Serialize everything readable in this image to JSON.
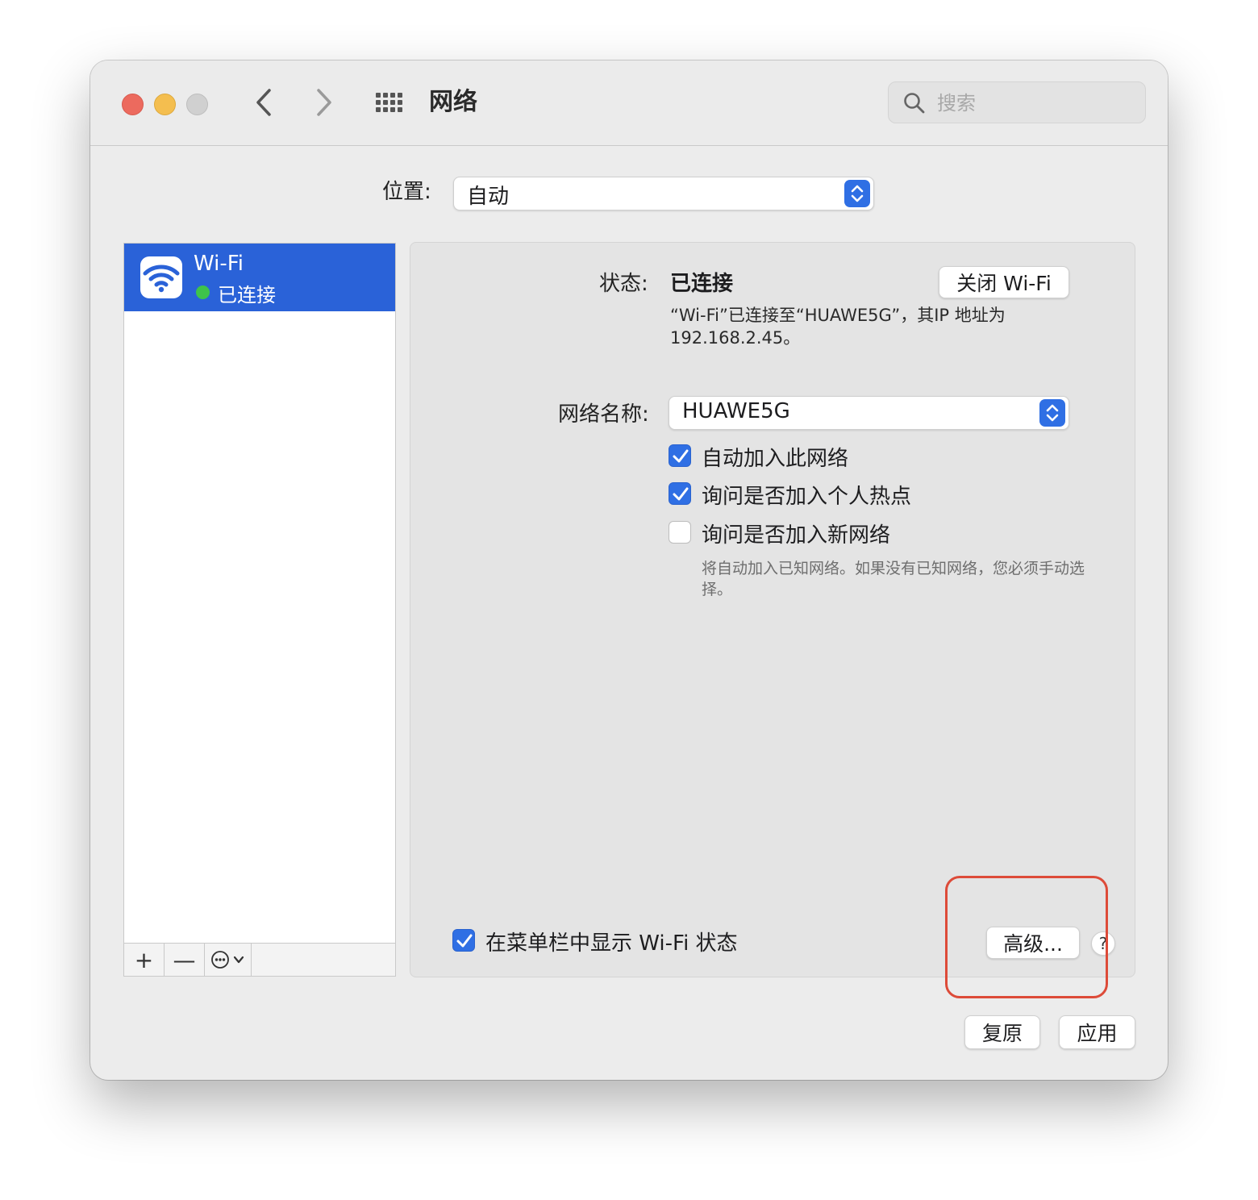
{
  "window": {
    "title": "网络",
    "search_placeholder": "搜索"
  },
  "location": {
    "label": "位置:",
    "value": "自动"
  },
  "sidebar": {
    "services": [
      {
        "name": "Wi-Fi",
        "status": "已连接",
        "status_color": "#3ec34a",
        "icon": "wifi-icon"
      }
    ],
    "toolbar": {
      "add": "+",
      "remove": "—"
    }
  },
  "detail": {
    "status_label": "状态:",
    "status_value": "已连接",
    "turn_off_button": "关闭 Wi-Fi",
    "status_desc": "“Wi-Fi”已连接至“HUAWE5G”，其IP 地址为 192.168.2.45。",
    "network_name_label": "网络名称:",
    "network_name_value": "HUAWE5G",
    "options": [
      {
        "label": "自动加入此网络",
        "checked": true
      },
      {
        "label": "询问是否加入个人热点",
        "checked": true
      },
      {
        "label": "询问是否加入新网络",
        "checked": false
      }
    ],
    "hint": "将自动加入已知网络。如果没有已知网络，您必须手动选择。",
    "show_menubar": {
      "label": "在菜单栏中显示 Wi-Fi 状态",
      "checked": true
    },
    "advanced_button": "高级...",
    "help": "?"
  },
  "footer": {
    "revert_button": "复原",
    "apply_button": "应用"
  },
  "colors": {
    "accent": "#2f6fe4",
    "selection": "#2a62d8",
    "highlight_box": "#dd4b39"
  }
}
